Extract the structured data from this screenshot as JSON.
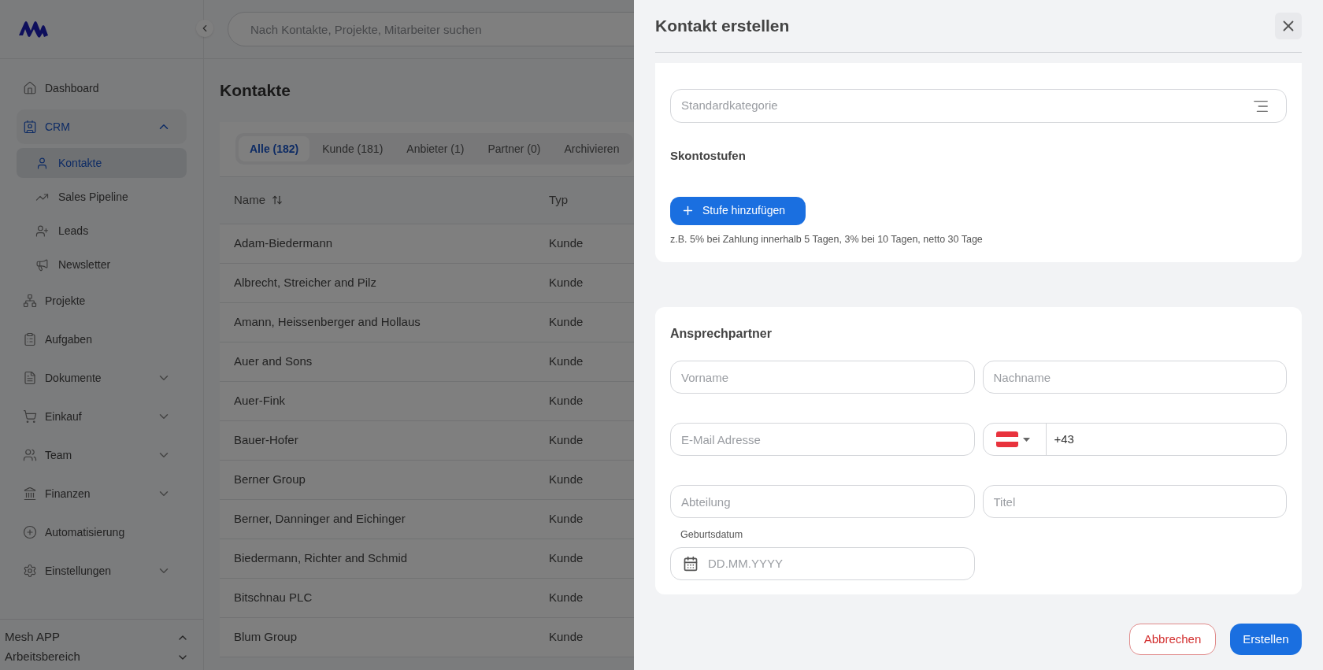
{
  "header": {
    "search": {
      "placeholder": "Nach Kontakte, Projekte, Mitarbeiter suchen"
    }
  },
  "sidebar": {
    "items": [
      {
        "label": "Dashboard",
        "selected": false
      },
      {
        "label": "CRM",
        "selected": true,
        "expanded": true,
        "children": [
          {
            "label": "Kontakte",
            "selected": true
          },
          {
            "label": "Sales Pipeline",
            "selected": false
          },
          {
            "label": "Leads",
            "selected": false
          },
          {
            "label": "Newsletter",
            "selected": false
          }
        ]
      },
      {
        "label": "Projekte",
        "selected": false
      },
      {
        "label": "Aufgaben",
        "selected": false
      },
      {
        "label": "Dokumente",
        "selected": false,
        "expanded": false
      },
      {
        "label": "Einkauf",
        "selected": false,
        "expanded": false
      },
      {
        "label": "Team",
        "selected": false,
        "expanded": false
      },
      {
        "label": "Finanzen",
        "selected": false,
        "expanded": false
      },
      {
        "label": "Automatisierung",
        "selected": false
      },
      {
        "label": "Einstellungen",
        "selected": false,
        "expanded": false
      }
    ],
    "workspace": [
      {
        "label": "Mesh APP",
        "expanded": true
      },
      {
        "label": "Arbeitsbereich",
        "expanded": false
      }
    ]
  },
  "page": {
    "title": "Kontakte",
    "tabs": [
      {
        "label": "Alle (182)",
        "selected": true
      },
      {
        "label": "Kunde (181)",
        "selected": false
      },
      {
        "label": "Anbieter (1)",
        "selected": false
      },
      {
        "label": "Partner (0)",
        "selected": false
      },
      {
        "label": "Archivieren",
        "selected": false
      }
    ],
    "table": {
      "columns": [
        "Name",
        "Typ"
      ],
      "rows": [
        [
          "Adam-Biedermann",
          "Kunde"
        ],
        [
          "Albrecht, Streicher and Pilz",
          "Kunde"
        ],
        [
          "Amann, Heissenberger and Hollaus",
          "Kunde"
        ],
        [
          "Auer and Sons",
          "Kunde"
        ],
        [
          "Auer-Fink",
          "Kunde"
        ],
        [
          "Bauer-Hofer",
          "Kunde"
        ],
        [
          "Berner Group",
          "Kunde"
        ],
        [
          "Berner, Danninger and Eichinger",
          "Kunde"
        ],
        [
          "Biedermann, Richter and Schmid",
          "Kunde"
        ],
        [
          "Bitschnau PLC",
          "Kunde"
        ],
        [
          "Blum Group",
          "Kunde"
        ]
      ]
    }
  },
  "drawer": {
    "title": "Kontakt erstellen",
    "category_field": {
      "placeholder": "Standardkategorie"
    },
    "discount": {
      "title": "Skontostufen",
      "button": "Stufe hinzufügen",
      "hint": "z.B. 5% bei Zahlung innerhalb 5 Tagen, 3% bei 10 Tagen, netto 30 Tage"
    },
    "contact": {
      "title": "Ansprechpartner",
      "first_name": {
        "placeholder": "Vorname"
      },
      "last_name": {
        "placeholder": "Nachname"
      },
      "email": {
        "placeholder": "E-Mail Adresse"
      },
      "phone": {
        "value": "+43"
      },
      "department": {
        "placeholder": "Abteilung"
      },
      "job_title": {
        "placeholder": "Titel"
      },
      "birthdate": {
        "label": "Geburtsdatum",
        "placeholder": "DD.MM.YYYY"
      }
    },
    "buttons": {
      "cancel": "Abbrechen",
      "submit": "Erstellen"
    }
  }
}
